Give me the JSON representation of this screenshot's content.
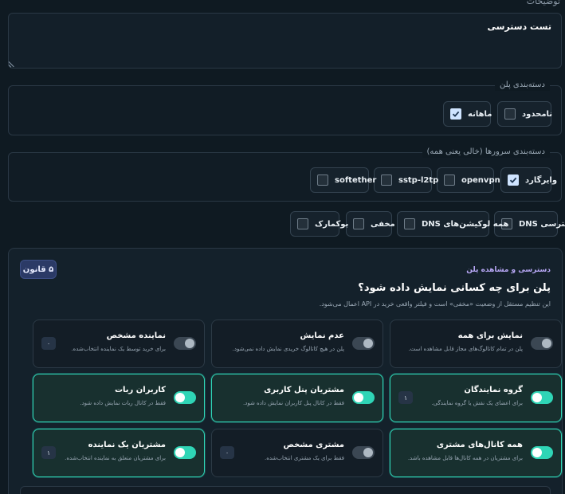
{
  "description": {
    "label": "توضیحات",
    "value": "تست دسترسی"
  },
  "plan_category": {
    "legend": "دسته‌بندی پلن",
    "options": [
      {
        "label": "نامحدود",
        "checked": false
      },
      {
        "label": "ماهانه",
        "checked": true
      }
    ]
  },
  "server_category": {
    "legend": "دسته‌بندی سرورها (خالی یعنی همه)",
    "options": [
      {
        "label": "وایرگارد",
        "checked": true
      },
      {
        "label": "openvpn",
        "checked": false
      },
      {
        "label": "sstp-l2tp",
        "checked": false
      },
      {
        "label": "softether",
        "checked": false
      }
    ]
  },
  "extra_options": [
    {
      "label": "دسترسی DNS",
      "checked": false
    },
    {
      "label": "همه لوکیشن‌های DNS",
      "checked": false
    },
    {
      "label": "مخفی",
      "checked": false
    },
    {
      "label": "بوکمارک",
      "checked": false
    }
  ],
  "visibility": {
    "kicker": "دسترسی و مشاهده پلن",
    "title": "پلن برای چه کسانی نمایش داده شود؟",
    "subtitle": "این تنظیم مستقل از وضعیت «مخفی» است و فیلتر واقعی خرید در API اعمال می‌شود.",
    "rules_badge": "۵ قانون",
    "cards": [
      {
        "title": "نمایش برای همه",
        "desc": "پلن در تمام کاتالوگ‌های مجاز قابل مشاهده است.",
        "on": false,
        "count": ""
      },
      {
        "title": "عدم نمایش",
        "desc": "پلن در هیچ کاتالوگ خریدی نمایش داده نمی‌شود.",
        "on": false,
        "count": ""
      },
      {
        "title": "نماینده مشخص",
        "desc": "برای خرید توسط یک نماینده انتخاب‌شده.",
        "on": false,
        "count": "۰"
      },
      {
        "title": "گروه نمایندگان",
        "desc": "برای اعضای یک نقش یا گروه نمایندگی.",
        "on": true,
        "count": "۱"
      },
      {
        "title": "مشتریان پنل کاربری",
        "desc": "فقط در کانال پنل کاربران نمایش داده شود.",
        "on": true,
        "count": ""
      },
      {
        "title": "کاربران ربات",
        "desc": "فقط در کانال ربات نمایش داده شود.",
        "on": true,
        "count": ""
      },
      {
        "title": "همه کانال‌های مشتری",
        "desc": "برای مشتریان در همه کانال‌ها قابل مشاهده باشد.",
        "on": true,
        "count": ""
      },
      {
        "title": "مشتری مشخص",
        "desc": "فقط برای یک مشتری انتخاب‌شده.",
        "on": false,
        "count": "۰"
      },
      {
        "title": "مشتریان یک نماینده",
        "desc": "برای مشتریان متعلق به نماینده انتخاب‌شده.",
        "on": true,
        "count": "۱"
      }
    ]
  },
  "colors": {
    "accent": "#2fd5b6",
    "badge": "#2b3a66",
    "kicker": "#b7a7f5"
  }
}
